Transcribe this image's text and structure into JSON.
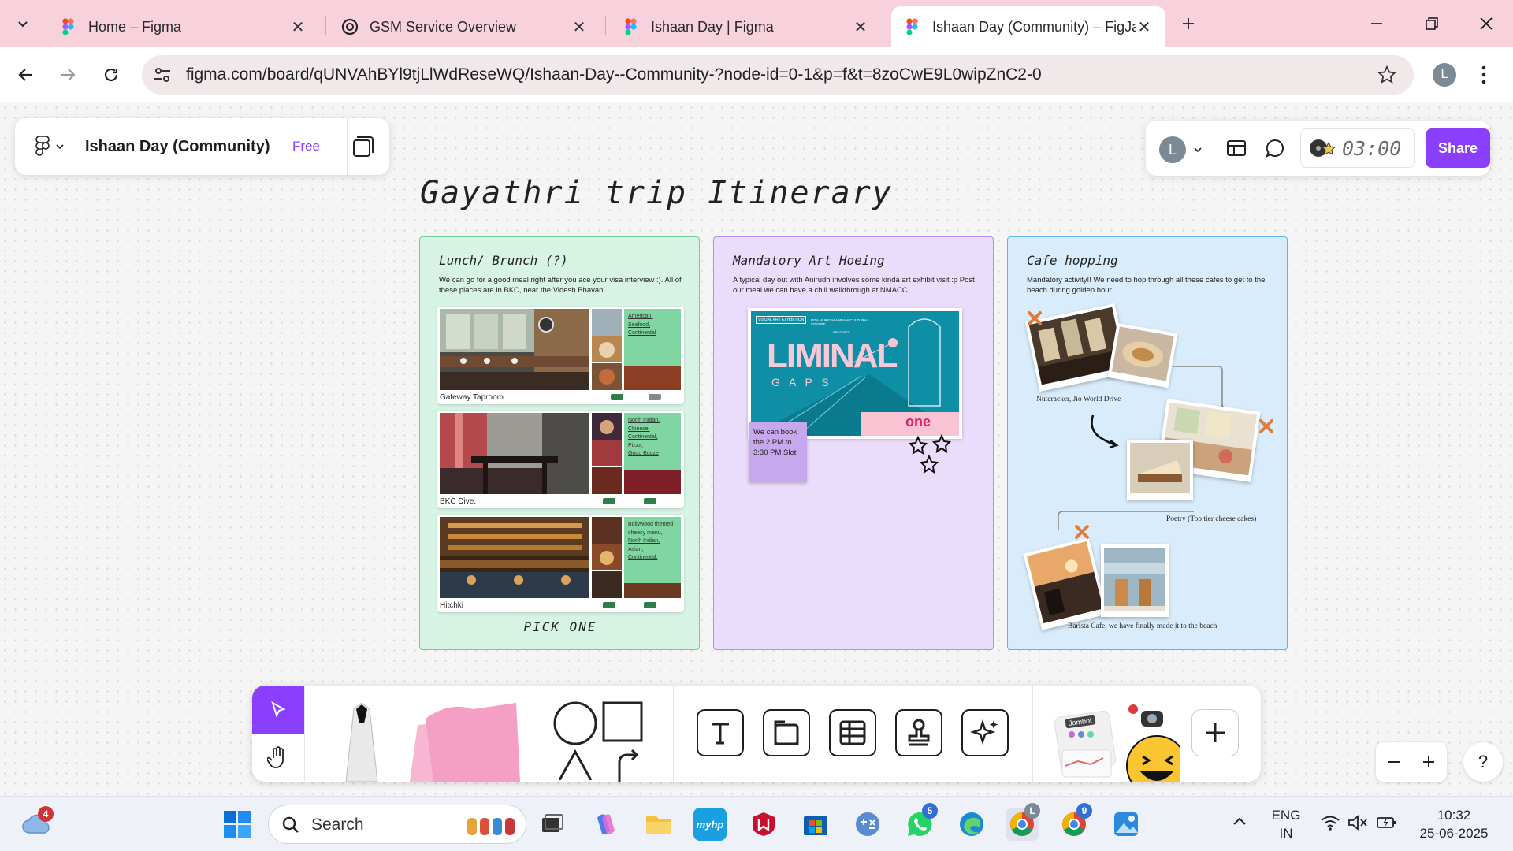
{
  "browser": {
    "tabs": [
      {
        "label": "Home – Figma",
        "active": false
      },
      {
        "label": "GSM Service Overview",
        "active": false
      },
      {
        "label": "Ishaan Day | Figma",
        "active": false
      },
      {
        "label": "Ishaan Day (Community) – FigJam",
        "active": true
      }
    ],
    "url": "figma.com/board/qUNVAhBYl9tjLlWdReseWQ/Ishaan-Day--Community-?node-id=0-1&p=f&t=8zoCwE9L0wipZnC2-0",
    "profile_initial": "L",
    "colors": {
      "tabbar": "#f7d2dc"
    }
  },
  "figma": {
    "file_name": "Ishaan Day (Community)",
    "plan_badge": "Free",
    "user_initial": "L",
    "timer": "03:00",
    "share_label": "Share",
    "accent": "#8a3ffc"
  },
  "board": {
    "title": "Gayathri trip  Itinerary",
    "sections": [
      {
        "title": "Lunch/ Brunch (?)",
        "description": "We can go for a good meal right after you ace your visa interview :). All of these places are in BKC, near the Videsh Bhavan",
        "color": "#d7f3e4",
        "restaurants": [
          {
            "name": "Gateway Taproom",
            "tags": [
              "American,",
              "Seafood,",
              "Continental"
            ]
          },
          {
            "name": "BKC Dive.",
            "tags": [
              "North Indian,",
              "Chinese,",
              "Continental,",
              "Pizza,",
              "Good Booze"
            ]
          },
          {
            "name": "Hitchki",
            "intro": "Bollywood themed cheesy menu,",
            "tags": [
              "North Indian,",
              "Asian,",
              "Continental,"
            ]
          }
        ],
        "footer": "PICK ONE"
      },
      {
        "title": "Mandatory Art Hoeing",
        "description": "A typical day out with Anirudh involves some kinda art exhibit visit :p Post our meal we can have a chill walkthrough at NMACC",
        "color": "#eadcfb",
        "poster": {
          "badge": "VISUAL ART EXHIBITION",
          "org": "NITA MUKESH AMBANI CULTURAL CENTRE",
          "presents": "PRESENTS",
          "headline": "LIMINAL",
          "subhead": "G A P S",
          "logo": "one"
        },
        "sticky": "We can book the 2 PM to 3:30 PM Slot",
        "sticky_color": "#c7a7ee"
      },
      {
        "title": "Cafe hopping",
        "description": "Mandatory activity!! We need to hop through all these cafes to get to the beach during golden hour",
        "color": "#d8ecfb",
        "captions": [
          "Nutcracker, Jio World Drive",
          "Poetry (Top tier cheese cakes)",
          "Barista Cafe, we have finally made it to the beach"
        ]
      }
    ]
  },
  "dock": {
    "tools": [
      "move-tool",
      "hand-tool",
      "marker-tool",
      "sticky-note-tool",
      "shape-tool",
      "connector-tool",
      "text-tool",
      "section-tool",
      "table-tool",
      "stamp-tool",
      "ai-tool",
      "widgets",
      "more-tools"
    ],
    "widget_label": "Jambot"
  },
  "taskbar": {
    "search_placeholder": "Search",
    "language": "ENG",
    "region": "IN",
    "time": "10:32",
    "date": "25-06-2025",
    "weather_badge": "4",
    "whatsapp_badge": "5",
    "chrome_profile_badge": "L",
    "chrome2_badge": "9"
  }
}
